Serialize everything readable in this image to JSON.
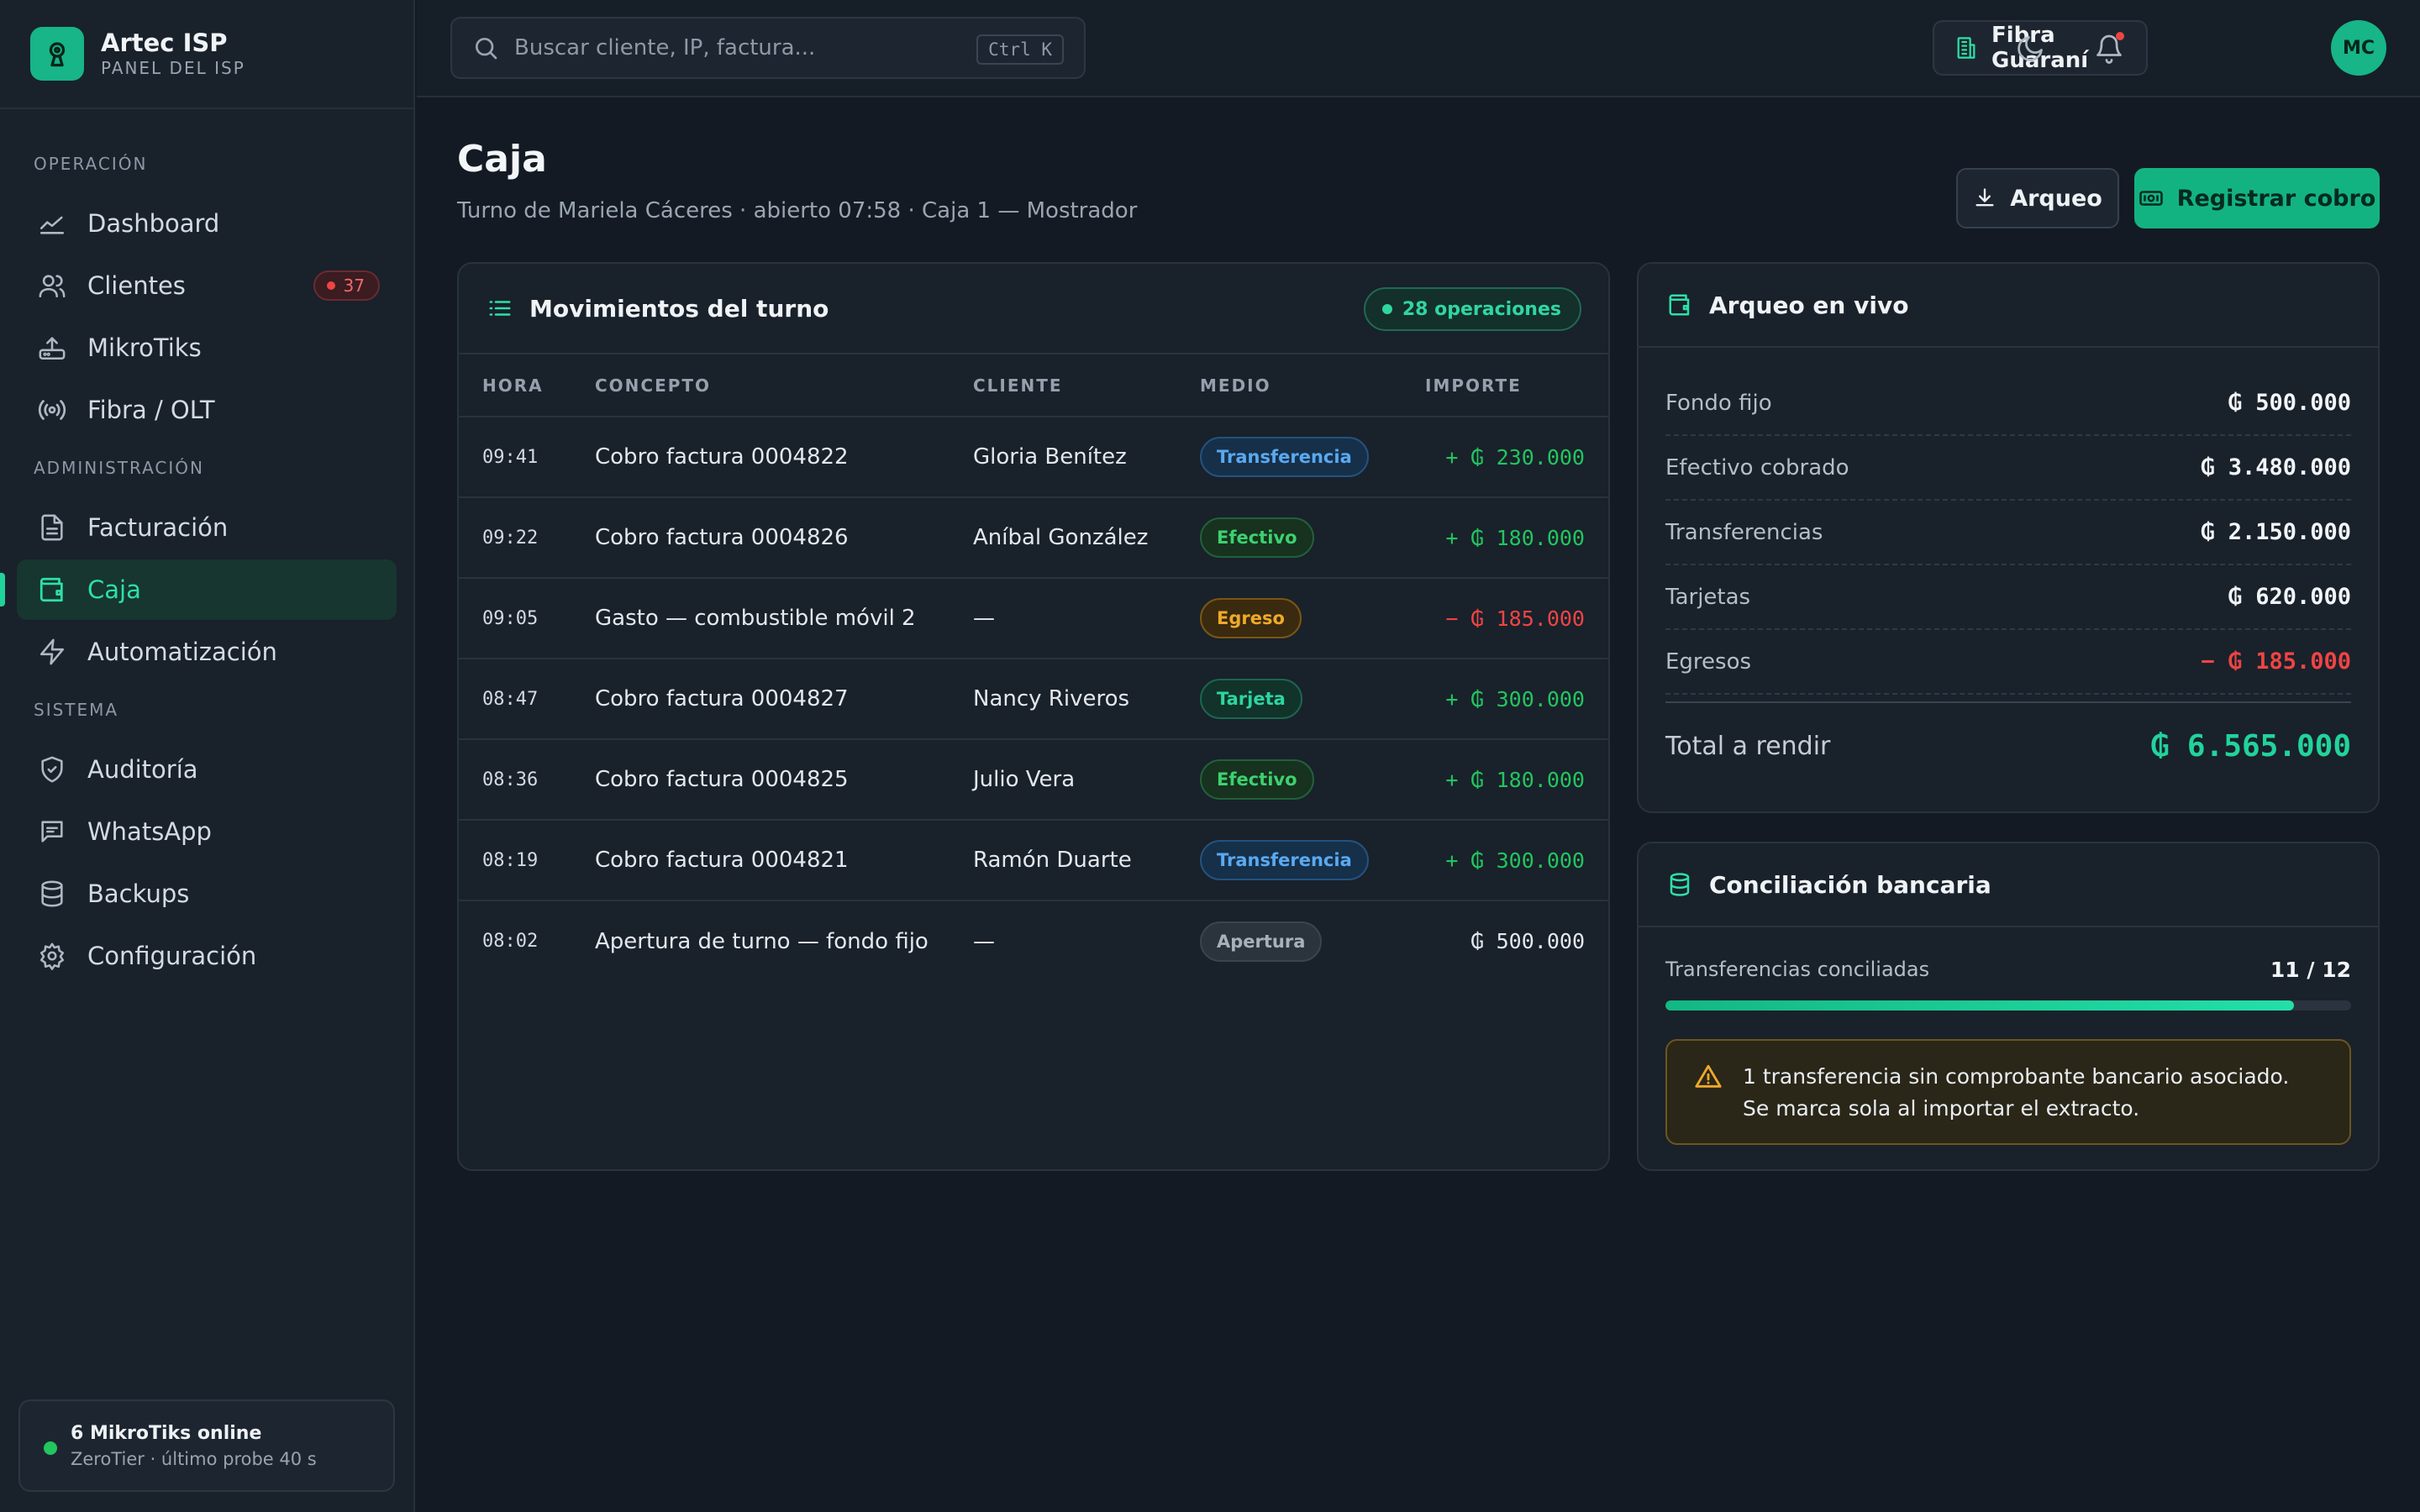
{
  "app": {
    "name": "Artec ISP",
    "subtitle": "PANEL DEL ISP"
  },
  "sidebar": {
    "sections": [
      {
        "title": "OPERACIÓN"
      },
      {
        "title": "ADMINISTRACIÓN"
      },
      {
        "title": "SISTEMA"
      }
    ],
    "items": [
      {
        "label": "Dashboard",
        "icon": "chart-line-icon"
      },
      {
        "label": "Clientes",
        "icon": "users-icon",
        "badge": "37"
      },
      {
        "label": "MikroTiks",
        "icon": "router-icon"
      },
      {
        "label": "Fibra / OLT",
        "icon": "radio-icon"
      },
      {
        "label": "Facturación",
        "icon": "file-text-icon"
      },
      {
        "label": "Caja",
        "icon": "wallet-icon",
        "active": true
      },
      {
        "label": "Automatización",
        "icon": "zap-icon"
      },
      {
        "label": "Auditoría",
        "icon": "shield-check-icon"
      },
      {
        "label": "WhatsApp",
        "icon": "message-icon"
      },
      {
        "label": "Backups",
        "icon": "database-icon"
      },
      {
        "label": "Configuración",
        "icon": "gear-icon"
      }
    ],
    "status": {
      "title": "6 MikroTiks online",
      "subtitle": "ZeroTier · último probe 40 s"
    }
  },
  "topbar": {
    "search_placeholder": "Buscar cliente, IP, factura...",
    "shortcut": "Ctrl K",
    "org": "Fibra Guaraní",
    "avatar": "MC"
  },
  "page": {
    "title": "Caja",
    "subtitle": "Turno de Mariela Cáceres · abierto 07:58 · Caja 1 — Mostrador",
    "btn_arqueo": "Arqueo",
    "btn_cobro": "Registrar cobro"
  },
  "movimientos": {
    "title": "Movimientos del turno",
    "badge": "28 operaciones",
    "columns": [
      "HORA",
      "CONCEPTO",
      "CLIENTE",
      "MEDIO",
      "IMPORTE"
    ],
    "rows": [
      {
        "hora": "09:41",
        "concepto": "Cobro factura 0004822",
        "cliente": "Gloria Benítez",
        "medio": "Transferencia",
        "importe": "+ ₲ 230.000"
      },
      {
        "hora": "09:22",
        "concepto": "Cobro factura 0004826",
        "cliente": "Aníbal González",
        "medio": "Efectivo",
        "importe": "+ ₲ 180.000"
      },
      {
        "hora": "09:05",
        "concepto": "Gasto — combustible móvil 2",
        "cliente": "—",
        "medio": "Egreso",
        "importe": "− ₲ 185.000"
      },
      {
        "hora": "08:47",
        "concepto": "Cobro factura 0004827",
        "cliente": "Nancy Riveros",
        "medio": "Tarjeta",
        "importe": "+ ₲ 300.000"
      },
      {
        "hora": "08:36",
        "concepto": "Cobro factura 0004825",
        "cliente": "Julio Vera",
        "medio": "Efectivo",
        "importe": "+ ₲ 180.000"
      },
      {
        "hora": "08:19",
        "concepto": "Cobro factura 0004821",
        "cliente": "Ramón Duarte",
        "medio": "Transferencia",
        "importe": "+ ₲ 300.000"
      },
      {
        "hora": "08:02",
        "concepto": "Apertura de turno — fondo fijo",
        "cliente": "—",
        "medio": "Apertura",
        "importe": "₲ 500.000"
      }
    ]
  },
  "arqueo": {
    "title": "Arqueo en vivo",
    "rows": [
      {
        "label": "Fondo fijo",
        "value": "₲ 500.000"
      },
      {
        "label": "Efectivo cobrado",
        "value": "₲ 3.480.000"
      },
      {
        "label": "Transferencias",
        "value": "₲ 2.150.000"
      },
      {
        "label": "Tarjetas",
        "value": "₲ 620.000"
      },
      {
        "label": "Egresos",
        "value": "− ₲ 185.000"
      }
    ],
    "total_label": "Total a rendir",
    "total_value": "₲ 6.565.000"
  },
  "conciliacion": {
    "title": "Conciliación bancaria",
    "label": "Transferencias conciliadas",
    "count": "11 / 12",
    "progress": 0.917,
    "warning": "1 transferencia sin comprobante bancario asociado. Se marca sola al importar el extracto."
  },
  "colors": {
    "accent": "#17b587",
    "danger": "#ef4444",
    "success": "#22c55e",
    "warning": "#f0a92a"
  }
}
